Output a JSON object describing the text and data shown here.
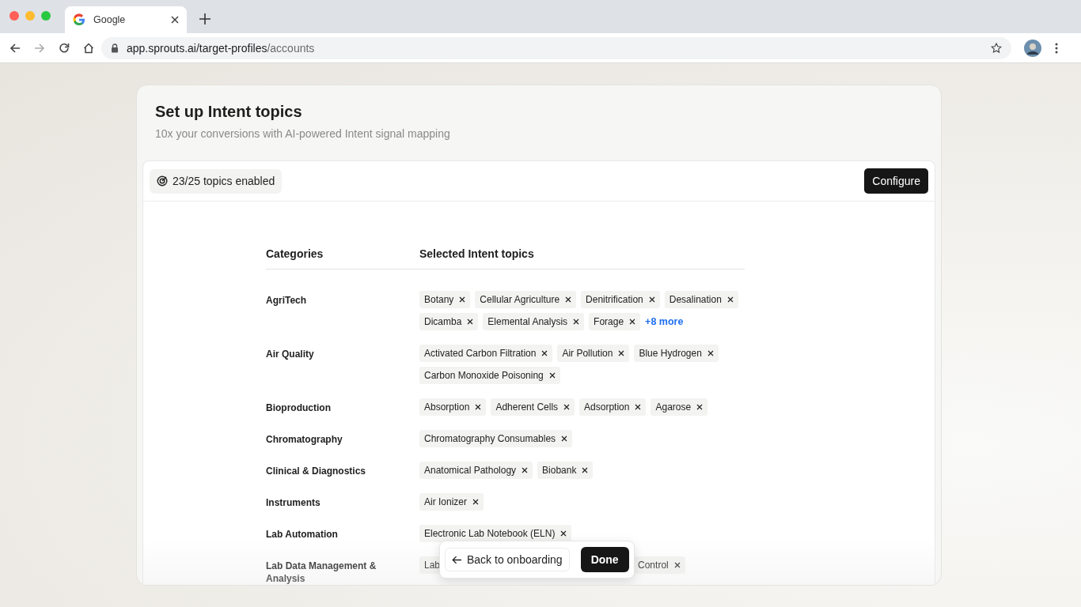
{
  "browser": {
    "tab_title": "Google",
    "url_host": "app.sprouts.ai/target-profiles",
    "url_path": "/accounts"
  },
  "page": {
    "title": "Set up Intent topics",
    "subtitle": "10x your conversions with AI-powered Intent signal mapping"
  },
  "toolbar": {
    "topics_count": "23/25 topics enabled",
    "configure_button": "Configure"
  },
  "table": {
    "columns": [
      "Categories",
      "Selected Intent topics"
    ],
    "rows": [
      {
        "category": "AgriTech",
        "topics": [
          "Botany",
          "Cellular Agriculture",
          "Denitrification",
          "Desalination",
          "Dicamba",
          "Elemental Analysis",
          "Forage"
        ],
        "more": "+8 more"
      },
      {
        "category": "Air Quality",
        "topics": [
          "Activated Carbon Filtration",
          "Air Pollution",
          "Blue Hydrogen",
          "Carbon Monoxide Poisoning"
        ]
      },
      {
        "category": "Bioproduction",
        "topics": [
          "Absorption",
          "Adherent Cells",
          "Adsorption",
          "Agarose"
        ]
      },
      {
        "category": "Chromatography",
        "topics": [
          "Chromatography Consumables"
        ]
      },
      {
        "category": "Clinical & Diagnostics",
        "topics": [
          "Anatomical Pathology",
          "Biobank"
        ]
      },
      {
        "category": "Instruments",
        "topics": [
          "Air Ionizer"
        ]
      },
      {
        "category": "Lab Automation",
        "topics": [
          "Electronic Lab Notebook (ELN)"
        ]
      },
      {
        "category": "Lab Data Management & Analysis",
        "topics": [
          {
            "parts": [
              "Lab",
              "Control"
            ]
          }
        ]
      }
    ]
  },
  "footer": {
    "back_button": "Back to onboarding",
    "done_button": "Done"
  }
}
